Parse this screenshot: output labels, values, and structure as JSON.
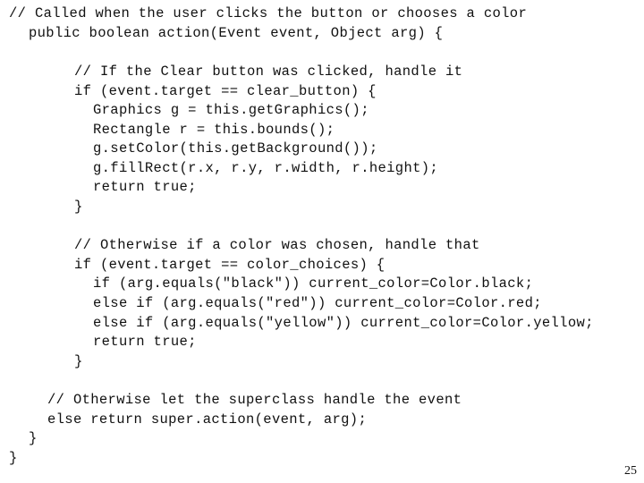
{
  "code_lines": [
    {
      "indent": 0,
      "text": "// Called when the user clicks the button or chooses a color"
    },
    {
      "indent": 2,
      "text": "public boolean action(Event event, Object arg) {"
    },
    {
      "indent": 0,
      "text": ""
    },
    {
      "indent": 8,
      "text": "// If the Clear button was clicked, handle it"
    },
    {
      "indent": 8,
      "text": "if (event.target == clear_button) {"
    },
    {
      "indent": 10,
      "text": "Graphics g = this.getGraphics();"
    },
    {
      "indent": 10,
      "text": "Rectangle r = this.bounds();"
    },
    {
      "indent": 10,
      "text": "g.setColor(this.getBackground());"
    },
    {
      "indent": 10,
      "text": "g.fillRect(r.x, r.y, r.width, r.height);"
    },
    {
      "indent": 10,
      "text": "return true;"
    },
    {
      "indent": 8,
      "text": "}"
    },
    {
      "indent": 0,
      "text": ""
    },
    {
      "indent": 8,
      "text": "// Otherwise if a color was chosen, handle that"
    },
    {
      "indent": 8,
      "text": "if (event.target == color_choices) {"
    },
    {
      "indent": 10,
      "text": "if (arg.equals(\"black\")) current_color=Color.black;"
    },
    {
      "indent": 10,
      "text": "else if (arg.equals(\"red\")) current_color=Color.red;"
    },
    {
      "indent": 10,
      "text": "else if (arg.equals(\"yellow\")) current_color=Color.yellow;"
    },
    {
      "indent": 10,
      "text": "return true;"
    },
    {
      "indent": 8,
      "text": "}"
    },
    {
      "indent": 0,
      "text": ""
    },
    {
      "indent": 5,
      "text": "// Otherwise let the superclass handle the event"
    },
    {
      "indent": 5,
      "text": "else return super.action(event, arg);"
    },
    {
      "indent": 3,
      "text": "}"
    },
    {
      "indent": 0,
      "text": "}"
    }
  ],
  "page_number": "25"
}
